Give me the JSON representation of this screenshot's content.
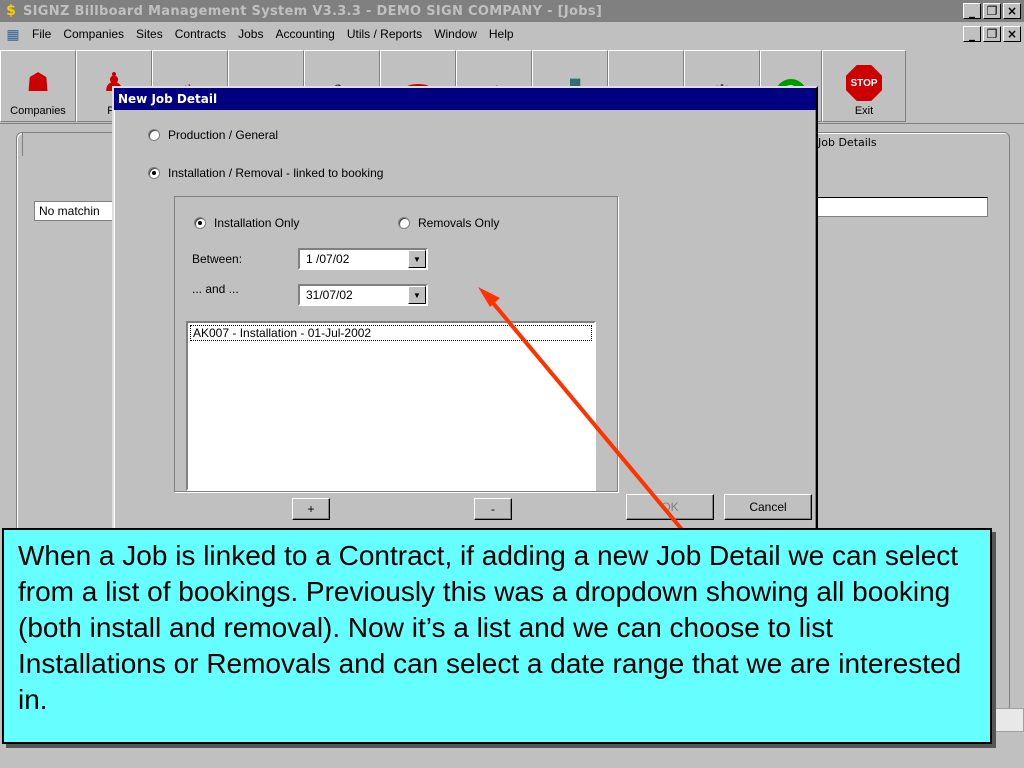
{
  "window": {
    "title": "SIGNZ Billboard Management System V3.3.3 - DEMO SIGN COMPANY - [Jobs]",
    "controls": [
      "_",
      "̅",
      "×"
    ]
  },
  "menu": {
    "items": [
      "File",
      "Companies",
      "Sites",
      "Contracts",
      "Jobs",
      "Accounting",
      "Utils / Reports",
      "Window",
      "Help"
    ]
  },
  "toolbar": {
    "companies_label": "Companies",
    "people_label": "Pe",
    "exit_label": "Exit",
    "stop_text": "STOP",
    "icons": [
      "companies-icon",
      "people-icon",
      "dog-icon",
      "folder-icon",
      "pen-icon",
      "phone-icon",
      "notepad-icon",
      "building-icon",
      "files-icon",
      "wrench-icon",
      "help-icon",
      "stop-icon"
    ]
  },
  "background": {
    "job_details_tab": "Job Details",
    "no_matching": "No matchin"
  },
  "dialog": {
    "title": "New Job Detail",
    "option_production": "Production / General",
    "option_installation": "Installation / Removal - linked to booking",
    "installation_only": "Installation Only",
    "removals_only": "Removals Only",
    "between_label": "Between:",
    "between_value": "1 /07/02",
    "and_label": "... and ...",
    "and_value": "31/07/02",
    "list_items": [
      "AK007 - Installation - 01-Jul-2002"
    ],
    "plus_button": "+",
    "minus_button": "-",
    "ok_button": "OK",
    "cancel_button": "Cancel"
  },
  "callout": {
    "text": "When a Job is linked to a Contract, if adding a new Job Detail we can select from a list of bookings.  Previously this was a dropdown showing all booking (both install and removal).  Now it’s a list and we can choose to list Installations or Removals and can select a date range that we are interested in."
  },
  "colors": {
    "callout_bg": "#66ffff",
    "arrow": "#ff3300",
    "dialog_title_bg": "#000080"
  }
}
